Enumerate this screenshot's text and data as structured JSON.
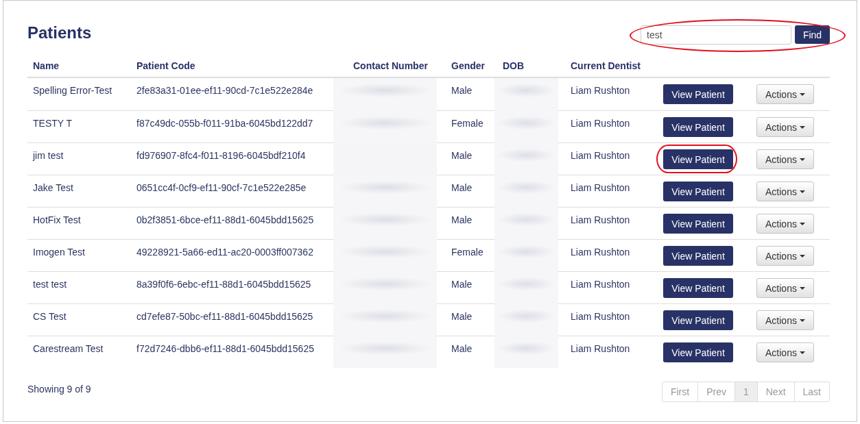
{
  "page": {
    "title": "Patients"
  },
  "search": {
    "value": "test",
    "button": "Find",
    "highlighted": true
  },
  "table": {
    "columns": [
      "Name",
      "Patient Code",
      "Contact Number",
      "Gender",
      "DOB",
      "Current Dentist"
    ],
    "rows": [
      {
        "name": "Spelling Error-Test",
        "patient_code": "2fe83a31-01ee-ef11-90cd-7c1e522e284e",
        "contact_blurred": true,
        "gender": "Male",
        "dob_blurred": true,
        "dentist": "Liam Rushton",
        "view_button": "View Patient",
        "view_highlighted": false,
        "actions_button": "Actions"
      },
      {
        "name": "TESTY T",
        "patient_code": "f87c49dc-055b-f011-91ba-6045bd122dd7",
        "contact_blurred": true,
        "gender": "Female",
        "dob_blurred": true,
        "dentist": "Liam Rushton",
        "view_button": "View Patient",
        "view_highlighted": false,
        "actions_button": "Actions"
      },
      {
        "name": "jim test",
        "patient_code": "fd976907-8fc4-f011-8196-6045bdf210f4",
        "contact_blurred": false,
        "gender": "Male",
        "dob_blurred": true,
        "dentist": "Liam Rushton",
        "view_button": "View Patient",
        "view_highlighted": true,
        "actions_button": "Actions"
      },
      {
        "name": "Jake Test",
        "patient_code": "0651cc4f-0cf9-ef11-90cf-7c1e522e285e",
        "contact_blurred": true,
        "gender": "Male",
        "dob_blurred": true,
        "dentist": "Liam Rushton",
        "view_button": "View Patient",
        "view_highlighted": false,
        "actions_button": "Actions"
      },
      {
        "name": "HotFix Test",
        "patient_code": "0b2f3851-6bce-ef11-88d1-6045bdd15625",
        "contact_blurred": true,
        "gender": "Male",
        "dob_blurred": true,
        "dentist": "Liam Rushton",
        "view_button": "View Patient",
        "view_highlighted": false,
        "actions_button": "Actions"
      },
      {
        "name": "Imogen Test",
        "patient_code": "49228921-5a66-ed11-ac20-0003ff007362",
        "contact_blurred": true,
        "gender": "Female",
        "dob_blurred": true,
        "dentist": "Liam Rushton",
        "view_button": "View Patient",
        "view_highlighted": false,
        "actions_button": "Actions"
      },
      {
        "name": "test test",
        "patient_code": "8a39f0f6-6ebc-ef11-88d1-6045bdd15625",
        "contact_blurred": true,
        "gender": "Male",
        "dob_blurred": true,
        "dentist": "Liam Rushton",
        "view_button": "View Patient",
        "view_highlighted": false,
        "actions_button": "Actions"
      },
      {
        "name": "CS Test",
        "patient_code": "cd7efe87-50bc-ef11-88d1-6045bdd15625",
        "contact_blurred": true,
        "gender": "Male",
        "dob_blurred": true,
        "dentist": "Liam Rushton",
        "view_button": "View Patient",
        "view_highlighted": false,
        "actions_button": "Actions"
      },
      {
        "name": "Carestream Test",
        "patient_code": "f72d7246-dbb6-ef11-88d1-6045bdd15625",
        "contact_blurred": true,
        "gender": "Male",
        "dob_blurred": true,
        "dentist": "Liam Rushton",
        "view_button": "View Patient",
        "view_highlighted": false,
        "actions_button": "Actions"
      }
    ]
  },
  "footer": {
    "summary": "Showing 9 of 9"
  },
  "pagination": [
    {
      "label": "First",
      "selected": false
    },
    {
      "label": "Prev",
      "selected": false
    },
    {
      "label": "1",
      "selected": true
    },
    {
      "label": "Next",
      "selected": false
    },
    {
      "label": "Last",
      "selected": false
    }
  ]
}
